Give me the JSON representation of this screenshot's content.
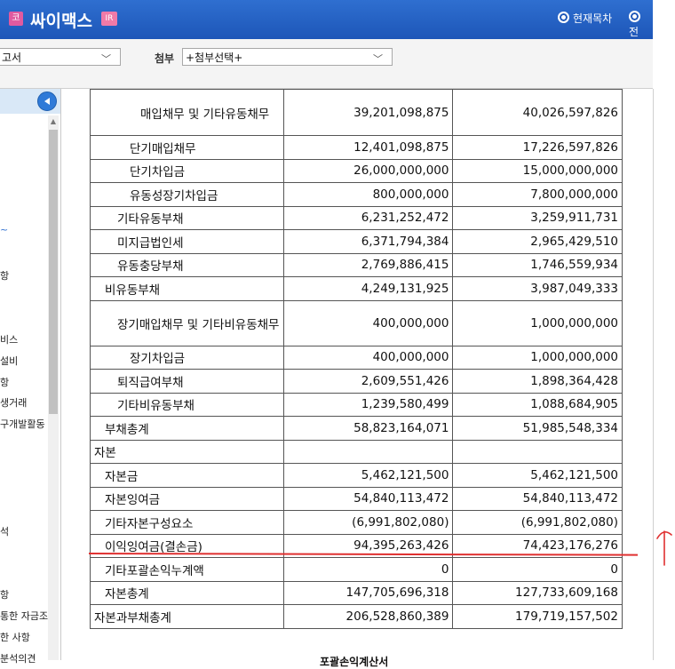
{
  "header": {
    "ko_badge": "코",
    "title": "싸이맥스",
    "ir_badge": "IR",
    "radio_current": "현재목차",
    "radio_all": "전"
  },
  "toolbar": {
    "report_select": "고서",
    "attach_label": "첨부",
    "attach_select": "+첨부선택+"
  },
  "sidebar": {
    "items": [
      "비스",
      "설비",
      "항",
      "생거래",
      "구개발활동",
      "석",
      "항",
      "통한 자금조",
      "한 사항",
      "분석의견"
    ],
    "markers": [
      "~",
      "항"
    ]
  },
  "table": {
    "rows": [
      {
        "label": "매입채무 및 기타유동채무",
        "cur": "39,201,098,875",
        "prev": "40,026,597,826"
      },
      {
        "label": "단기매입채무",
        "cur": "12,401,098,875",
        "prev": "17,226,597,826"
      },
      {
        "label": "단기차입금",
        "cur": "26,000,000,000",
        "prev": "15,000,000,000"
      },
      {
        "label": "유동성장기차입금",
        "cur": "800,000,000",
        "prev": "7,800,000,000"
      },
      {
        "label": "기타유동부채",
        "cur": "6,231,252,472",
        "prev": "3,259,911,731"
      },
      {
        "label": "미지급법인세",
        "cur": "6,371,794,384",
        "prev": "2,965,429,510"
      },
      {
        "label": "유동충당부채",
        "cur": "2,769,886,415",
        "prev": "1,746,559,934"
      },
      {
        "label": "비유동부채",
        "cur": "4,249,131,925",
        "prev": "3,987,049,333"
      },
      {
        "label": "장기매입채무 및 기타비유동채무",
        "cur": "400,000,000",
        "prev": "1,000,000,000"
      },
      {
        "label": "장기차입금",
        "cur": "400,000,000",
        "prev": "1,000,000,000"
      },
      {
        "label": "퇴직급여부채",
        "cur": "2,609,551,426",
        "prev": "1,898,364,428"
      },
      {
        "label": "기타비유동부채",
        "cur": "1,239,580,499",
        "prev": "1,088,684,905"
      },
      {
        "label": "부채총계",
        "cur": "58,823,164,071",
        "prev": "51,985,548,334"
      },
      {
        "label": "자본",
        "cur": "",
        "prev": ""
      },
      {
        "label": "자본금",
        "cur": "5,462,121,500",
        "prev": "5,462,121,500"
      },
      {
        "label": "자본잉여금",
        "cur": "54,840,113,472",
        "prev": "54,840,113,472"
      },
      {
        "label": "기타자본구성요소",
        "cur": "(6,991,802,080)",
        "prev": "(6,991,802,080)"
      },
      {
        "label": "이익잉여금(결손금)",
        "cur": "94,395,263,426",
        "prev": "74,423,176,276"
      },
      {
        "label": "기타포괄손익누계액",
        "cur": "0",
        "prev": "0"
      },
      {
        "label": "자본총계",
        "cur": "147,705,696,318",
        "prev": "127,733,609,168"
      },
      {
        "label": "자본과부채총계",
        "cur": "206,528,860,389",
        "prev": "179,719,157,502"
      }
    ]
  },
  "footer_heading": "포괄손익계산서",
  "annotation": {
    "color": "#e03030"
  }
}
